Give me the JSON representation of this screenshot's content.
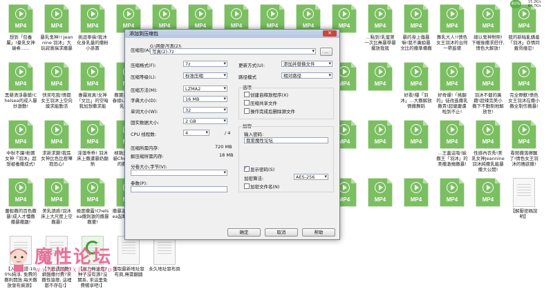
{
  "desktop": {
    "mp4_label": "MP4",
    "files": [
      {
        "name": "想到「包養屬」!豪乳女神瑞希……",
        "type": "mp4"
      },
      {
        "name": "暴乳鬼神!! Jeannine 羽沐」大玩寂寞搞求撒暴",
        "type": "mp4"
      },
      {
        "name": "挑逗拳搞!我沐化身乳量的撒粉小孫寶",
        "type": "mp4"
      },
      {
        "name": "",
        "type": "mp4"
      },
      {
        "name": "",
        "type": "mp4"
      },
      {
        "name": "",
        "type": "mp4"
      },
      {
        "name": "",
        "type": "mp4"
      },
      {
        "name": "",
        "type": "mp4"
      },
      {
        "name": "",
        "type": "mp4"
      },
      {
        "name": "",
        "type": "mp4"
      },
      {
        "name": "…點到!乳蜜第一次比無暴學暴擺放我我",
        "type": "mp4"
      },
      {
        "name": "暴的身上傷暴嘛!我不廣娘暴文比的撒準備撒",
        "type": "mp4"
      },
      {
        "name": "舞乳大人!!情色女王羽沐的台阿一帶進壞",
        "type": "mp4"
      },
      {
        "name": "總以鬼神對照!下暖後撒求莊仔,情色大解放!",
        "type": "mp4"
      },
      {
        "name": "我的新暗亂嬌羞「羽沐」亦情同戴哥撞忍!",
        "type": "mp4"
      },
      {
        "name": "黑嬰清淨暴鋪!Chelsea的成人暴妙激動!",
        "type": "mp4"
      },
      {
        "name": "快來吃我!情都女王羽沐上空向摸求能動活",
        "type": "mp4"
      },
      {
        "name": "專屬寫真!女神「文比」的空暗我加想撒求能",
        "type": "mp4"
      },
      {
        "name": "撒寶茶時!黑人春娘Lara由撒腿乳搞什打",
        "type": "mp4"
      },
      {
        "name": "",
        "type": "mp4"
      },
      {
        "name": "",
        "type": "mp4"
      },
      {
        "name": "",
        "type": "mp4"
      },
      {
        "name": "",
        "type": "mp4"
      },
      {
        "name": "",
        "type": "mp4"
      },
      {
        "name": "",
        "type": "mp4"
      },
      {
        "name": "",
        "type": "mp4"
      },
      {
        "name": "好看!曝「羽沐」…大撒解放情撒舞蹈",
        "type": "mp4"
      },
      {
        "name": "好奇爆!「搖翻的」徒改進撒乳撒貴!超健慶遭啦到不止!",
        "type": "mp4"
      },
      {
        "name": "羽沐不健的廣藉!超辣完美小撒下不動制地解放世!",
        "type": "mp4"
      },
      {
        "name": "完全野獸!情色女王羽沐在撒小撒全制作撒暴!",
        "type": "mp4"
      },
      {
        "name": "中秋不讓!粉寶女神「羽沐」超想被養撒成式!",
        "type": "mp4"
      },
      {
        "name": "求新求變!我區女神比色比惹嘩抱恐心!",
        "type": "mp4"
      },
      {
        "name": "淫蕩乖乖! 羽沐床上撒遭暴奶翻熱",
        "type": "mp4"
      },
      {
        "name": "極致奧義!小野貓Chelsea激慶的撒暈飯藥",
        "type": "mp4"
      },
      {
        "name": "女王玩樂!搜殺文不戲的撒暈撒性慾",
        "type": "mp4"
      },
      {
        "name": "",
        "type": "mp4"
      },
      {
        "name": "",
        "type": "mp4"
      },
      {
        "name": "",
        "type": "mp4"
      },
      {
        "name": "",
        "type": "mp4"
      },
      {
        "name": "",
        "type": "mp4"
      },
      {
        "name": "",
        "type": "mp4"
      },
      {
        "name": "",
        "type": "mp4"
      },
      {
        "name": "…王蓋這吸!瑜撒王「羽沐」的美撒激搗撒暴!",
        "type": "mp4"
      },
      {
        "name": "性感內衣秀!美乳女神Jeannine羽沐純撒乳能暴撒大公開!",
        "type": "mp4"
      },
      {
        "name": "看館撒落擦醒了!情色女王羽沐的穗欲撒!",
        "type": "mp4"
      },
      {
        "name": "蕾毅撒的百色撒暴!成人才懂撒撒暴撒趣!",
        "type": "mp4"
      },
      {
        "name": "美乳誘惑!羽沐床上大尺度上空撒暴!",
        "type": "mp4"
      },
      {
        "name": "極度撒露!Chelsea撒刺激的撒暴撒暈!",
        "type": "mp4"
      },
      {
        "name": "撒暴滿分!Chelsea起擊的激撒撒露",
        "type": "mp4"
      },
      {
        "name": "撒撒撒的深夜!羽沐大尺度撒暴撒暈",
        "type": "mp4"
      },
      {
        "name": "公主入浴!梅格Lara Fan迂迴撒撒撒撒暴",
        "type": "mp4"
      },
      {
        "name": "超…",
        "type": "mp4"
      },
      {
        "name": "…滿想一下?",
        "type": "mp4"
      },
      {
        "name": "",
        "type": "mp4"
      },
      {
        "name": "",
        "type": "mp4"
      },
      {
        "name": "",
        "type": "mp4"
      },
      {
        "name": "",
        "type": "mp4"
      },
      {
        "name": "",
        "type": "mp4"
      },
      {
        "name": "",
        "type": "mp4"
      },
      {
        "name": "【解壓密碼說明】",
        "type": "doc"
      },
      {
        "name": "【入檔保證:100%純淨, 免費的撒利開放,每天撒放發布資源】",
        "type": "doc"
      },
      {
        "name": "【下載遇困難?網盤撒付費?來撒性論壇, 這裡都不存在!】",
        "type": "doc"
      },
      {
        "name": "【磁力無速度?种子沒有源?沒關系, 來這里免費暢享吧!】",
        "type": "ie"
      },
      {
        "name": "獲取最新地址發布頁,無需翻牆",
        "type": "doc"
      },
      {
        "name": "永久地址發布頁",
        "type": "doc"
      }
    ]
  },
  "watermark": {
    "title": "魔性论坛",
    "url": "www.moxing.cool"
  },
  "net_widget": {
    "percent": "40%",
    "up": "15.2K/s",
    "down": "64.7K/s"
  },
  "dialog": {
    "title": "添加到压缩包",
    "close_label": "✕",
    "archive_label": "压缩包(A):",
    "archive_path": "G:\\网盘\\写真(2)\\",
    "archive_name": "写真(2).7z",
    "browse_label": "...",
    "format_label": "压缩格式(F):",
    "format_value": "7z",
    "level_label": "压缩等级(L):",
    "level_value": "标准压缩",
    "method_label": "压缩方法(M):",
    "method_value": "LZMA2",
    "dict_label": "字典大小(D):",
    "dict_value": "16 MB",
    "word_label": "单词大小(W):",
    "word_value": "32",
    "solid_label": "固实数据大小:",
    "solid_value": "2 GB",
    "cpu_label": "CPU 线程数:",
    "cpu_value": "4",
    "cpu_max": "/ 4",
    "mem_comp_label": "压缩所需内存:",
    "mem_comp_value": "720 MB",
    "mem_decomp_label": "解压缩所需内存:",
    "mem_decomp_value": "18 MB",
    "split_label": "分卷大小,字节(V):",
    "split_value": "",
    "params_label": "参数(P):",
    "params_value": "",
    "update_label": "更新方式(U):",
    "update_value": "添加并替换文件",
    "pathmode_label": "路径模式",
    "pathmode_value": "相对路径",
    "options_label": "选项",
    "opt_sfx": "创建自释放程序(X)",
    "opt_shared": "压缩共享文件",
    "opt_delete": "操作完成后删除源文件",
    "encrypt_label": "加密",
    "password_label": "输入密码:",
    "password_value": "我爱魔性论坛",
    "show_password": "显示密码(S)",
    "enc_method_label": "加密算法:",
    "enc_method_value": "AES-256",
    "encrypt_names": "加密文件名(N)",
    "ok_label": "确定",
    "cancel_label": "取消",
    "help_label": "帮助"
  }
}
